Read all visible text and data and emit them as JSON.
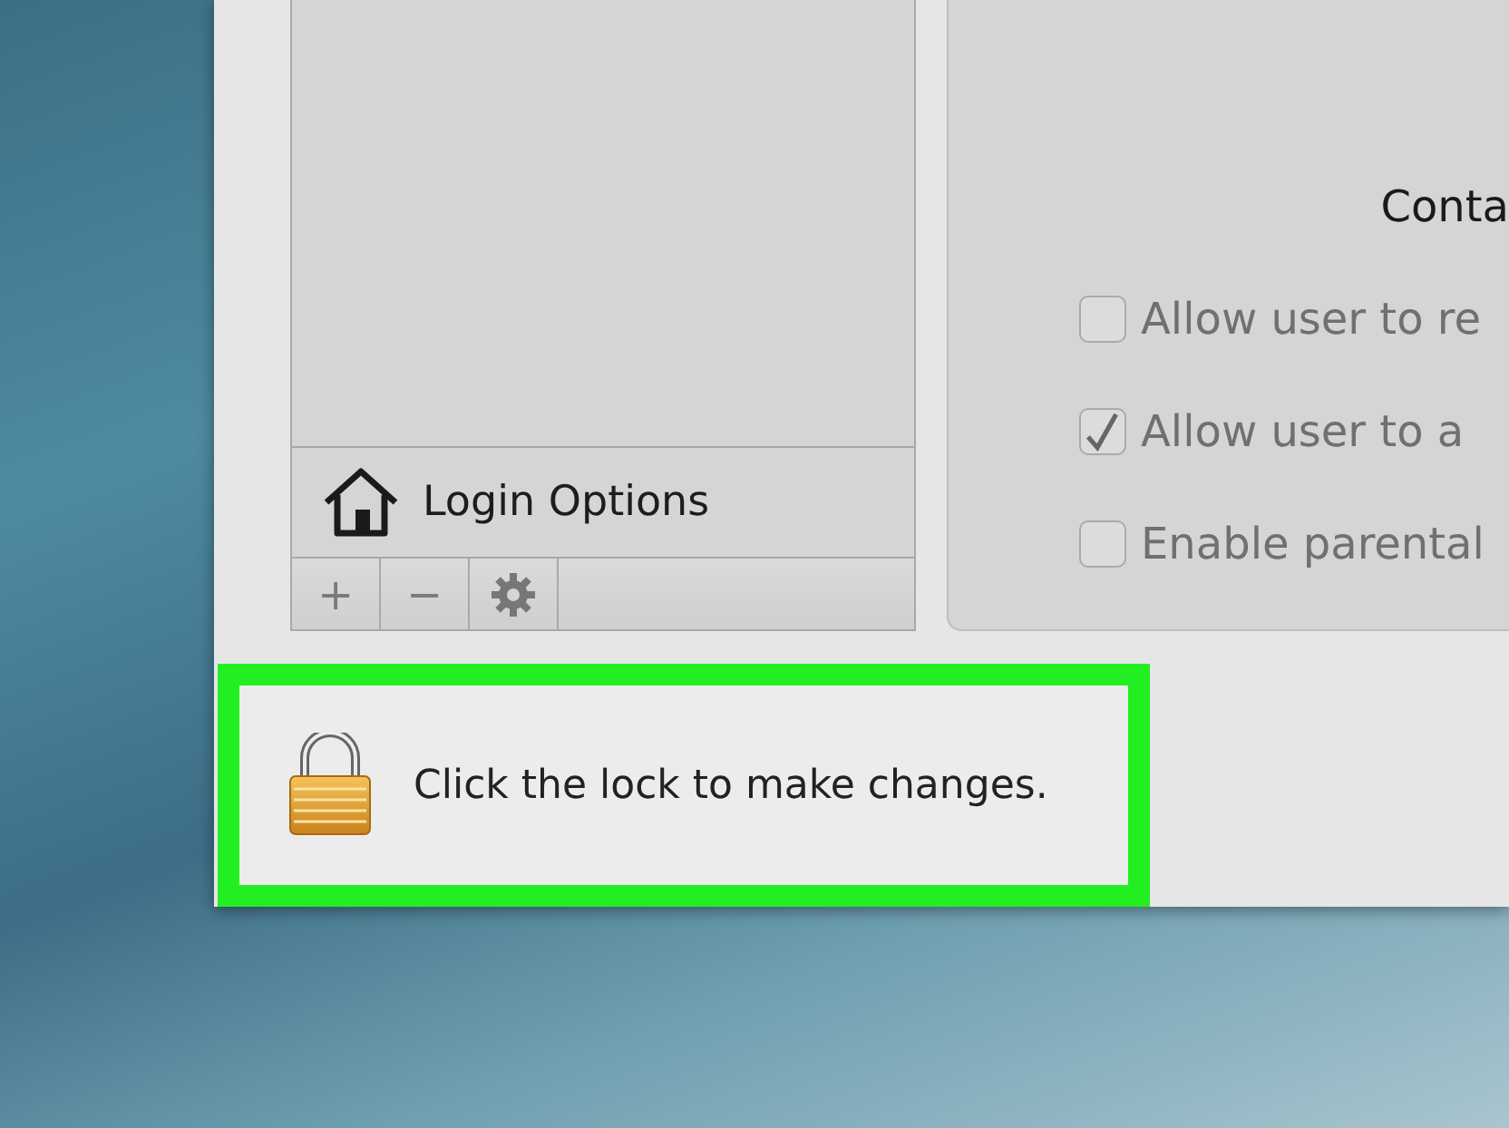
{
  "sidebar": {
    "footer_item": {
      "label": "Login Options"
    },
    "toolbar": [
      {
        "kind": "add",
        "label": "+"
      },
      {
        "kind": "remove",
        "label": "−"
      },
      {
        "kind": "gear"
      }
    ]
  },
  "detail": {
    "heading": "Conta",
    "options": [
      {
        "label": "Allow user to re",
        "checked": false,
        "disabled": true
      },
      {
        "label": "Allow user to a",
        "checked": true,
        "disabled": true
      },
      {
        "label": "Enable parental",
        "checked": false,
        "disabled": true
      }
    ]
  },
  "lock_bar": {
    "text": "Click the lock to make changes.",
    "highlighted": true
  }
}
